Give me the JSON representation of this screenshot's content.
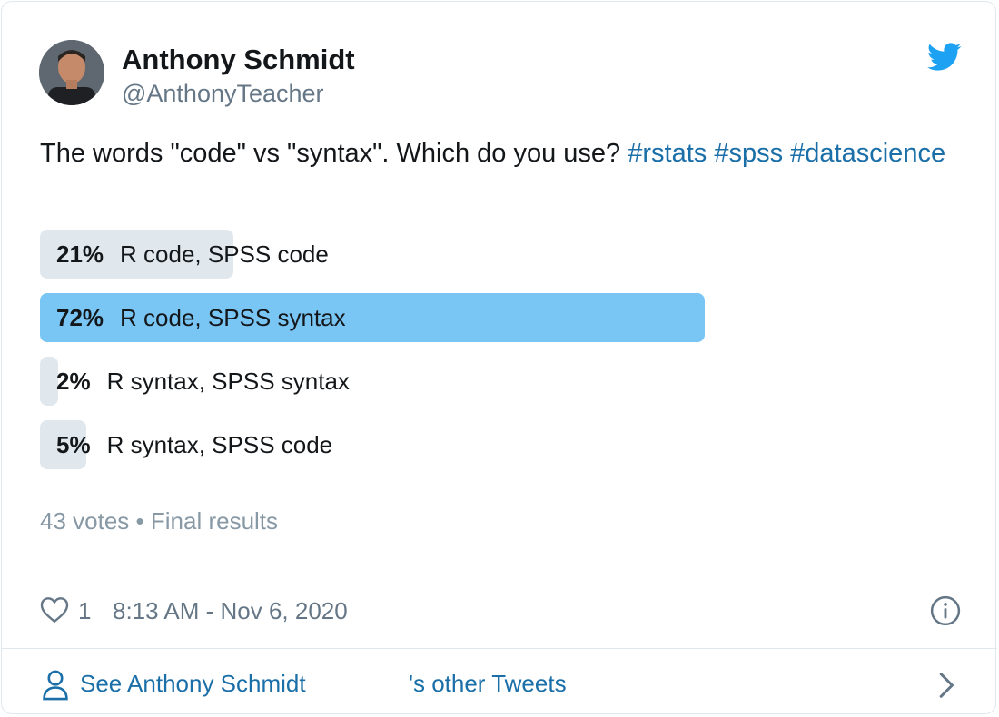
{
  "author": {
    "name": "Anthony Schmidt",
    "handle": "@AnthonyTeacher"
  },
  "tweet": {
    "text": "The words \"code\" vs \"syntax\". Which do you use? ",
    "hashtags": [
      "#rstats",
      "#spss",
      "#datascience"
    ]
  },
  "poll": {
    "options": [
      {
        "percent": "21%",
        "label": "R code, SPSS code",
        "value": 21,
        "winner": false
      },
      {
        "percent": "72%",
        "label": "R code, SPSS syntax",
        "value": 72,
        "winner": true
      },
      {
        "percent": "2%",
        "label": "R syntax, SPSS syntax",
        "value": 2,
        "winner": false
      },
      {
        "percent": "5%",
        "label": "R syntax, SPSS code",
        "value": 5,
        "winner": false
      }
    ],
    "votes": "43 votes",
    "separator": "•",
    "status": "Final results"
  },
  "footer": {
    "likes": "1",
    "timestamp": "8:13 AM - Nov 6, 2020"
  },
  "see_more": {
    "label_start": "See Anthony Schmidt",
    "label_end": "'s other Tweets"
  },
  "icons": {
    "brand": "twitter-bird-icon",
    "like": "heart-icon",
    "info": "info-icon",
    "profile": "person-icon",
    "next": "chevron-right-icon"
  },
  "colors": {
    "twitter_blue": "#1da1f2",
    "link": "#1b6fa8",
    "winner_bar": "#79c6f5",
    "bar": "#e1e8ed",
    "muted": "#657786"
  }
}
